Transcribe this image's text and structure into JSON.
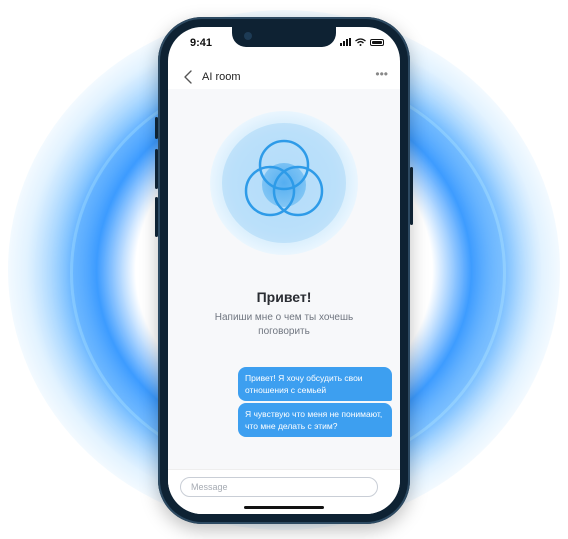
{
  "status_bar": {
    "time": "9:41"
  },
  "nav": {
    "title": "AI room",
    "more_glyph": "•••"
  },
  "greeting": {
    "title": "Привет!",
    "subtitle": "Напиши мне о чем ты хочешь поговорить"
  },
  "messages": [
    {
      "text": "Привет! Я хочу обсудить свои отношения с семьей",
      "sender": "user"
    },
    {
      "text": "Я чувствую что меня не понимают, что мне делать с этим?",
      "sender": "user"
    }
  ],
  "composer": {
    "placeholder": "Message"
  },
  "icons": {
    "back": "chevron-left-icon",
    "more": "more-horizontal-icon",
    "signal": "cellular-signal-icon",
    "wifi": "wifi-icon",
    "battery": "battery-icon"
  },
  "colors": {
    "accent": "#3d9ff0",
    "aura": "#1e8cff",
    "phone_frame": "#0e2233"
  }
}
